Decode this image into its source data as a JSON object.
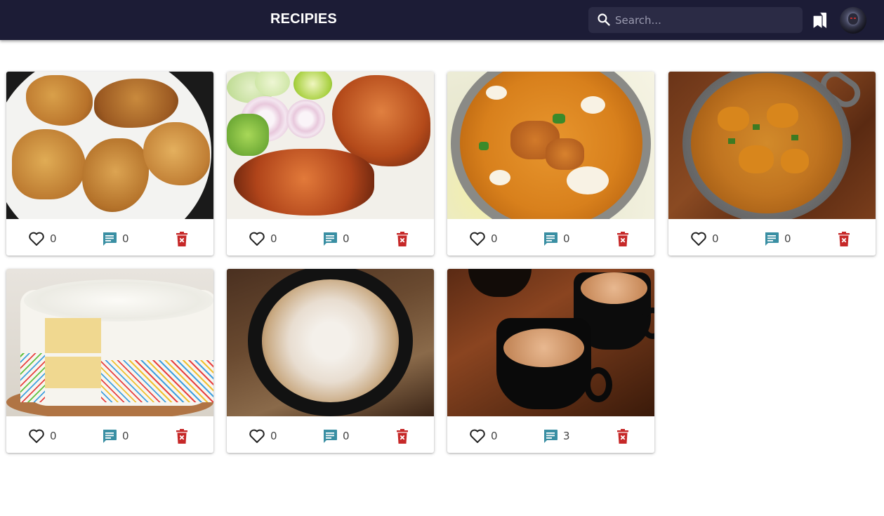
{
  "header": {
    "brand": "RECIPIES",
    "search_placeholder": "Search...",
    "search_value": "",
    "bookmark_icon": "bookmarks-icon",
    "avatar_icon": "user-avatar"
  },
  "colors": {
    "topbar": "#1c1c36",
    "search_bg": "#2b2b45",
    "comment_icon": "#3a8fa3",
    "delete_icon": "#c62828",
    "heart_icon": "#222222"
  },
  "recipes": [
    {
      "image": "fried-chicken-cutlets",
      "likes": "0",
      "comments": "0"
    },
    {
      "image": "grilled-fish-with-salad",
      "likes": "0",
      "comments": "0"
    },
    {
      "image": "butter-chicken-curry",
      "likes": "0",
      "comments": "0"
    },
    {
      "image": "chicken-curry-in-pan",
      "likes": "0",
      "comments": "0"
    },
    {
      "image": "vanilla-sprinkle-cake",
      "likes": "0",
      "comments": "0"
    },
    {
      "image": "cappuccino-cup",
      "likes": "0",
      "comments": "0"
    },
    {
      "image": "masala-chai-cups",
      "likes": "0",
      "comments": "3"
    }
  ]
}
